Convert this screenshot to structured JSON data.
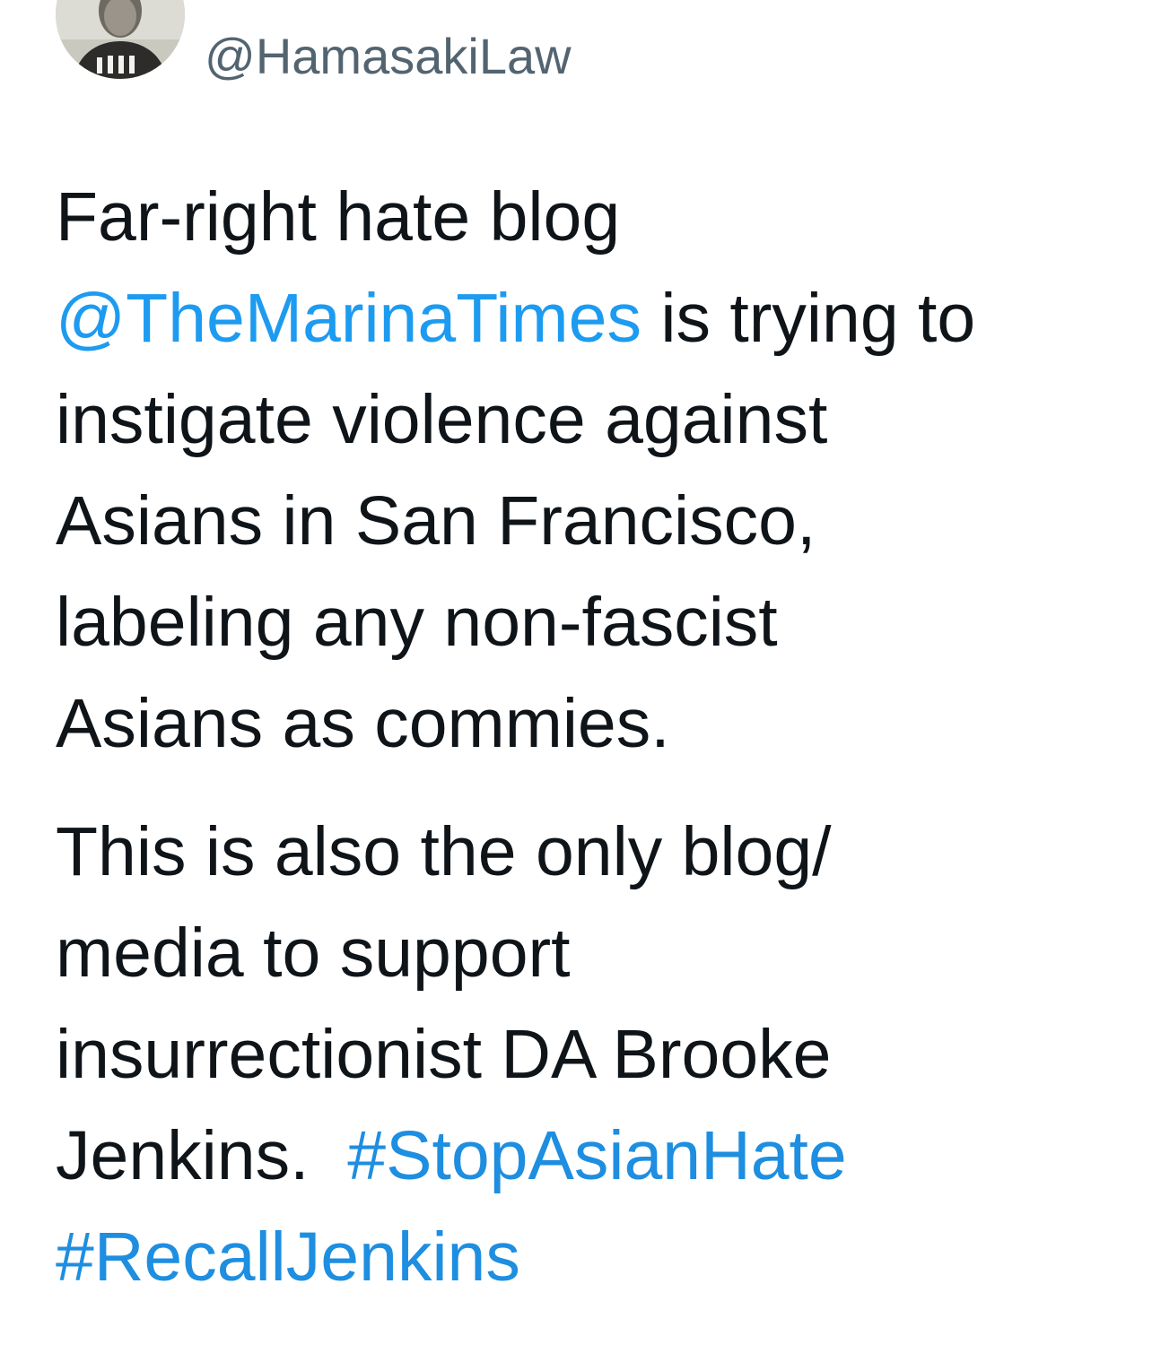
{
  "author": {
    "handle": "@HamasakiLaw"
  },
  "tweet": {
    "paragraph1": {
      "line1": "Far-right hate blog",
      "mention": "@TheMarinaTimes",
      "line2_rest": " is trying to",
      "line3": "instigate violence against",
      "line4": "Asians in San Francisco,",
      "line5": "labeling any non-fascist",
      "line6": "Asians as commies."
    },
    "paragraph2": {
      "line1": "This is also the only blog/",
      "line2": "media to support",
      "line3": "insurrectionist DA Brooke",
      "line4_text": "Jenkins.  ",
      "hashtag1": "#StopAsianHate",
      "hashtag2": "#RecallJenkins"
    }
  },
  "colors": {
    "link": "#1d9bf0",
    "text": "#0f1419",
    "secondary": "#536471"
  }
}
